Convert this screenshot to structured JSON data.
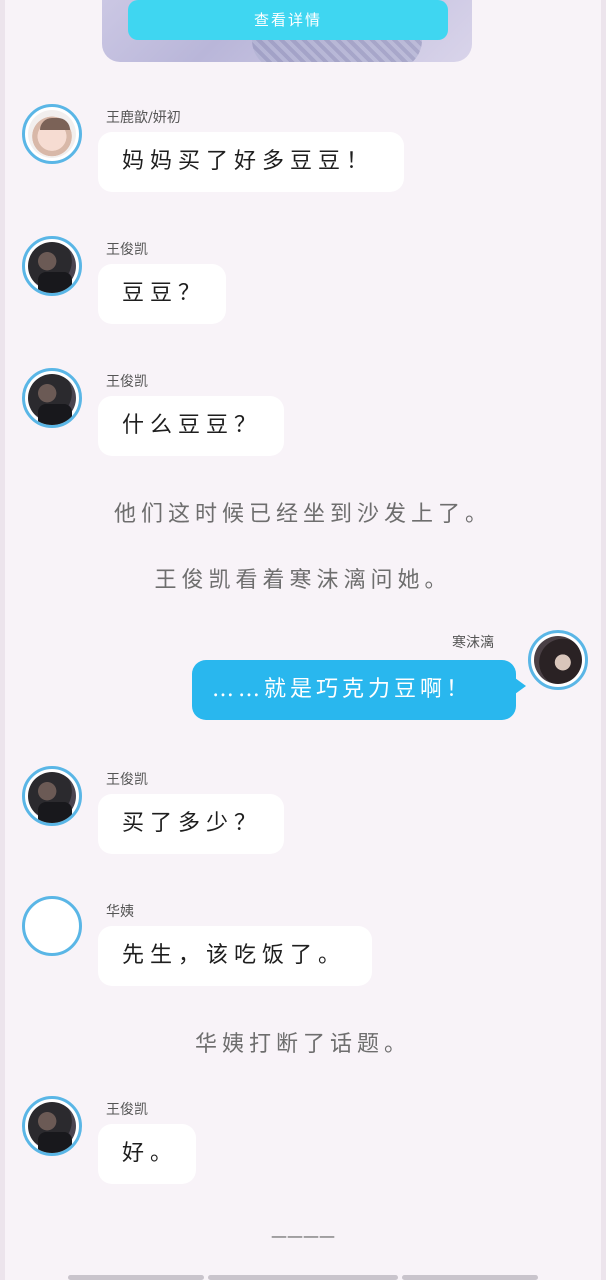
{
  "top_card": {
    "button_label": "查看详情"
  },
  "messages": [
    {
      "speaker": "王鹿歆/妍初",
      "text": "妈妈买了好多豆豆！",
      "avatar": "baby-avatar"
    },
    {
      "speaker": "王俊凯",
      "text": "豆豆？",
      "avatar": "wjk-avatar"
    },
    {
      "speaker": "王俊凯",
      "text": "什么豆豆？",
      "avatar": "wjk-avatar"
    },
    {
      "speaker": "寒沫漓",
      "text": "……就是巧克力豆啊！",
      "avatar": "han-avatar"
    },
    {
      "speaker": "王俊凯",
      "text": "买了多少？",
      "avatar": "wjk-avatar"
    },
    {
      "speaker": "华姨",
      "text": "先生，该吃饭了。",
      "avatar": "blank-avatar"
    },
    {
      "speaker": "王俊凯",
      "text": "好。",
      "avatar": "wjk-avatar"
    }
  ],
  "narration": [
    "他们这时候已经坐到沙发上了。",
    "王俊凯看着寒沫漓问她。",
    "华姨打断了话题。"
  ],
  "footer": {
    "divider": "————"
  },
  "colors": {
    "background": "#f8f3f8",
    "accent_button": "#3fd6f1",
    "right_bubble": "#29b7ee",
    "avatar_ring": "#5ab6e6"
  }
}
